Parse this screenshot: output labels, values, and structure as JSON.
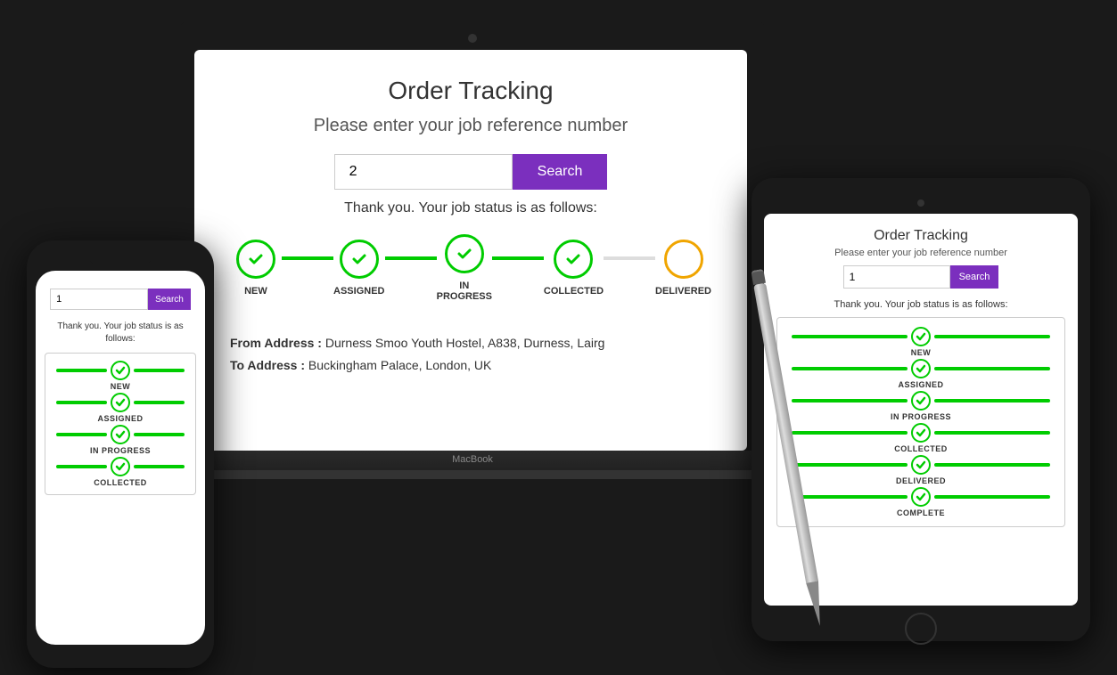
{
  "laptop": {
    "title": "Order Tracking",
    "subtitle": "Please enter your job reference number",
    "input_value": "2",
    "search_label": "Search",
    "status_text": "Thank you. Your job status is as follows:",
    "tracker_steps": [
      {
        "label": "NEW",
        "state": "complete"
      },
      {
        "label": "ASSIGNED",
        "state": "complete"
      },
      {
        "label": "IN PROGRESS",
        "state": "complete"
      },
      {
        "label": "COLLECTED",
        "state": "complete"
      },
      {
        "label": "DELIVERED",
        "state": "partial"
      }
    ],
    "from_address_label": "From Address :",
    "from_address": "Durness Smoo Youth Hostel, A838, Durness, Lairg",
    "to_address_label": "To Address :",
    "to_address": "Buckingham Palace, London, UK"
  },
  "tablet": {
    "title": "Order Tracking",
    "subtitle": "Please enter your job reference number",
    "input_value": "1",
    "search_label": "Search",
    "status_text": "Thank you. Your job status is as follows:",
    "tracker_steps": [
      {
        "label": "NEW",
        "state": "complete"
      },
      {
        "label": "ASSIGNED",
        "state": "complete"
      },
      {
        "label": "IN PROGRESS",
        "state": "complete"
      },
      {
        "label": "COLLECTED",
        "state": "complete"
      },
      {
        "label": "DELIVERED",
        "state": "complete"
      },
      {
        "label": "COMPLETE",
        "state": "complete"
      }
    ]
  },
  "phone": {
    "input_value": "1",
    "search_label": "Search",
    "status_text": "Thank you. Your job status is as follows:",
    "tracker_steps": [
      {
        "label": "NEW",
        "state": "complete"
      },
      {
        "label": "ASSIGNED",
        "state": "complete"
      },
      {
        "label": "IN PROGRESS",
        "state": "complete"
      },
      {
        "label": "COLLECTED",
        "state": "complete"
      }
    ]
  },
  "colors": {
    "purple": "#7b2fbe",
    "green": "#00cc00",
    "grey_line": "#ddd"
  }
}
